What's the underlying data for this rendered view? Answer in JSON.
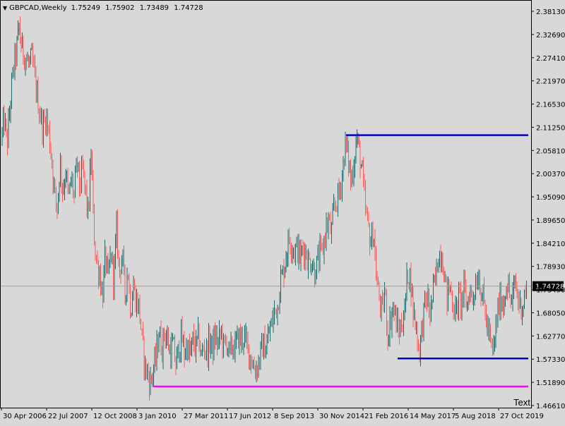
{
  "header": {
    "symbol": "GBPCAD,Weekly",
    "open": "1.75249",
    "high": "1.75902",
    "low": "1.73489",
    "close": "1.74728"
  },
  "corner_text": "Text",
  "colors": {
    "background": "#d8d8d8",
    "bull_candle": "#1e6b6b",
    "bear_candle": "#ff5a5a",
    "resistance_line": "#0000cc",
    "support_line": "#0000cc",
    "floor_line": "#ff00ff",
    "price_line": "#a0a0a0",
    "price_label_bg": "#000000",
    "price_label_fg": "#ffffff"
  },
  "chart_data": {
    "type": "candlestick",
    "instrument": "GBPCAD",
    "timeframe": "Weekly",
    "ylim": [
      1.4661,
      2.3947
    ],
    "y_ticks": [
      "2.38130",
      "2.32690",
      "2.27410",
      "2.21970",
      "2.16530",
      "2.11250",
      "2.05810",
      "2.00370",
      "1.95090",
      "1.89650",
      "1.84210",
      "1.78930",
      "1.73490",
      "1.68050",
      "1.62770",
      "1.57330",
      "1.51890",
      "1.46610"
    ],
    "x_ticks": [
      "30 Apr 2006",
      "22 Jul 2007",
      "12 Oct 2008",
      "3 Jan 2010",
      "27 Mar 2011",
      "17 Jun 2012",
      "8 Sep 2013",
      "30 Nov 2014",
      "21 Feb 2016",
      "14 May 2017",
      "5 Aug 2018",
      "27 Oct 2019"
    ],
    "current_price": "1.74728",
    "horizontal_lines": [
      {
        "price": 2.103,
        "from": "30 Nov 2014",
        "to": "end",
        "color": "#0000cc"
      },
      {
        "price": 1.577,
        "from": "21 Feb 2016",
        "to": "end",
        "color": "#0000cc"
      },
      {
        "price": 1.511,
        "from": "3 Jan 2010",
        "to": "end",
        "color": "#ff00ff"
      }
    ],
    "price_path": [
      [
        0,
        2.07
      ],
      [
        6,
        2.14
      ],
      [
        10,
        2.08
      ],
      [
        16,
        2.21
      ],
      [
        20,
        2.27
      ],
      [
        24,
        2.31
      ],
      [
        27,
        2.36
      ],
      [
        29,
        2.32
      ],
      [
        33,
        2.3
      ],
      [
        37,
        2.28
      ],
      [
        41,
        2.27
      ],
      [
        45,
        2.28
      ],
      [
        49,
        2.24
      ],
      [
        53,
        2.19
      ],
      [
        57,
        2.15
      ],
      [
        61,
        2.12
      ],
      [
        65,
        2.15
      ],
      [
        69,
        2.11
      ],
      [
        73,
        2.05
      ],
      [
        77,
        1.97
      ],
      [
        81,
        1.93
      ],
      [
        85,
        2.04
      ],
      [
        89,
        1.97
      ],
      [
        93,
        2.02
      ],
      [
        97,
        1.95
      ],
      [
        101,
        2.0
      ],
      [
        105,
        1.96
      ],
      [
        109,
        2.04
      ],
      [
        113,
        1.98
      ],
      [
        117,
        2.02
      ],
      [
        121,
        1.97
      ],
      [
        125,
        1.91
      ],
      [
        129,
        2.06
      ],
      [
        133,
        1.87
      ],
      [
        137,
        1.8
      ],
      [
        141,
        1.78
      ],
      [
        145,
        1.72
      ],
      [
        149,
        1.82
      ],
      [
        153,
        1.76
      ],
      [
        157,
        1.83
      ],
      [
        161,
        1.76
      ],
      [
        165,
        1.88
      ],
      [
        169,
        1.78
      ],
      [
        173,
        1.82
      ],
      [
        177,
        1.73
      ],
      [
        181,
        1.79
      ],
      [
        185,
        1.69
      ],
      [
        189,
        1.75
      ],
      [
        193,
        1.71
      ],
      [
        197,
        1.7
      ],
      [
        201,
        1.62
      ],
      [
        205,
        1.56
      ],
      [
        209,
        1.54
      ],
      [
        213,
        1.52
      ],
      [
        217,
        1.55
      ],
      [
        221,
        1.58
      ],
      [
        225,
        1.64
      ],
      [
        229,
        1.6
      ],
      [
        233,
        1.64
      ],
      [
        237,
        1.62
      ],
      [
        241,
        1.59
      ],
      [
        245,
        1.61
      ],
      [
        249,
        1.56
      ],
      [
        253,
        1.6
      ],
      [
        257,
        1.63
      ],
      [
        261,
        1.59
      ],
      [
        265,
        1.61
      ],
      [
        269,
        1.58
      ],
      [
        273,
        1.62
      ],
      [
        277,
        1.6
      ],
      [
        281,
        1.63
      ],
      [
        285,
        1.58
      ],
      [
        289,
        1.61
      ],
      [
        293,
        1.59
      ],
      [
        297,
        1.62
      ],
      [
        301,
        1.6
      ],
      [
        305,
        1.63
      ],
      [
        309,
        1.61
      ],
      [
        313,
        1.64
      ],
      [
        317,
        1.6
      ],
      [
        321,
        1.62
      ],
      [
        325,
        1.58
      ],
      [
        329,
        1.61
      ],
      [
        333,
        1.6
      ],
      [
        337,
        1.63
      ],
      [
        341,
        1.62
      ],
      [
        345,
        1.63
      ],
      [
        349,
        1.61
      ],
      [
        353,
        1.59
      ],
      [
        357,
        1.57
      ],
      [
        361,
        1.55
      ],
      [
        365,
        1.56
      ],
      [
        369,
        1.59
      ],
      [
        373,
        1.61
      ],
      [
        377,
        1.6
      ],
      [
        381,
        1.64
      ],
      [
        385,
        1.66
      ],
      [
        389,
        1.69
      ],
      [
        393,
        1.7
      ],
      [
        397,
        1.76
      ],
      [
        401,
        1.78
      ],
      [
        405,
        1.82
      ],
      [
        409,
        1.86
      ],
      [
        413,
        1.85
      ],
      [
        417,
        1.83
      ],
      [
        421,
        1.84
      ],
      [
        425,
        1.81
      ],
      [
        429,
        1.84
      ],
      [
        433,
        1.83
      ],
      [
        437,
        1.8
      ],
      [
        441,
        1.81
      ],
      [
        445,
        1.78
      ],
      [
        449,
        1.8
      ],
      [
        453,
        1.82
      ],
      [
        457,
        1.83
      ],
      [
        461,
        1.88
      ],
      [
        465,
        1.9
      ],
      [
        469,
        1.87
      ],
      [
        473,
        1.93
      ],
      [
        477,
        1.95
      ],
      [
        481,
        1.97
      ],
      [
        485,
        2.02
      ],
      [
        489,
        2.08
      ],
      [
        493,
        2.05
      ],
      [
        497,
        1.99
      ],
      [
        501,
        2.04
      ],
      [
        505,
        2.1
      ],
      [
        509,
        2.06
      ],
      [
        513,
        2.01
      ],
      [
        517,
        1.93
      ],
      [
        521,
        1.89
      ],
      [
        525,
        1.85
      ],
      [
        529,
        1.88
      ],
      [
        533,
        1.76
      ],
      [
        537,
        1.72
      ],
      [
        541,
        1.68
      ],
      [
        545,
        1.74
      ],
      [
        549,
        1.63
      ],
      [
        553,
        1.67
      ],
      [
        557,
        1.7
      ],
      [
        561,
        1.66
      ],
      [
        565,
        1.64
      ],
      [
        569,
        1.66
      ],
      [
        573,
        1.69
      ],
      [
        577,
        1.78
      ],
      [
        581,
        1.77
      ],
      [
        585,
        1.69
      ],
      [
        589,
        1.66
      ],
      [
        593,
        1.59
      ],
      [
        597,
        1.64
      ],
      [
        601,
        1.7
      ],
      [
        605,
        1.72
      ],
      [
        609,
        1.68
      ],
      [
        613,
        1.73
      ],
      [
        617,
        1.77
      ],
      [
        621,
        1.82
      ],
      [
        625,
        1.83
      ],
      [
        629,
        1.78
      ],
      [
        633,
        1.72
      ],
      [
        637,
        1.75
      ],
      [
        641,
        1.71
      ],
      [
        645,
        1.68
      ],
      [
        649,
        1.72
      ],
      [
        653,
        1.71
      ],
      [
        657,
        1.74
      ],
      [
        661,
        1.7
      ],
      [
        665,
        1.74
      ],
      [
        669,
        1.72
      ],
      [
        673,
        1.75
      ],
      [
        677,
        1.78
      ],
      [
        681,
        1.74
      ],
      [
        685,
        1.71
      ],
      [
        689,
        1.66
      ],
      [
        693,
        1.63
      ],
      [
        697,
        1.58
      ],
      [
        701,
        1.63
      ],
      [
        705,
        1.69
      ],
      [
        709,
        1.72
      ],
      [
        713,
        1.7
      ],
      [
        717,
        1.76
      ],
      [
        721,
        1.73
      ],
      [
        725,
        1.7
      ],
      [
        729,
        1.76
      ],
      [
        733,
        1.72
      ],
      [
        737,
        1.7
      ],
      [
        741,
        1.71
      ],
      [
        745,
        1.74
      ]
    ]
  }
}
